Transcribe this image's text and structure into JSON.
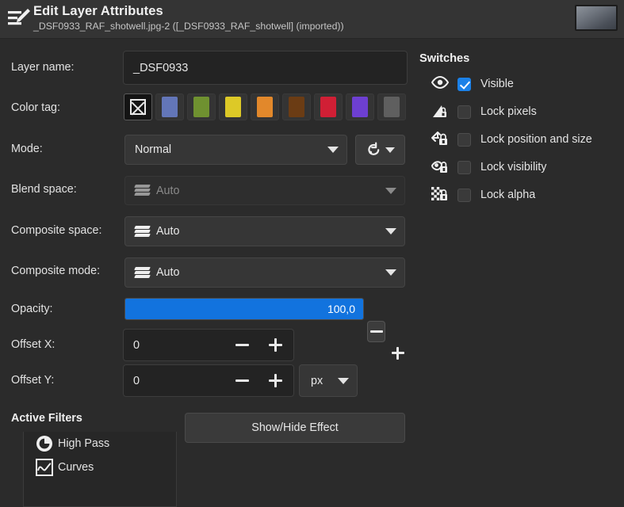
{
  "window": {
    "title": "Edit Layer Attributes",
    "subtitle": "_DSF0933_RAF_shotwell.jpg-2 ([_DSF0933_RAF_shotwell] (imported))",
    "header_icon": "edit-layer-attributes-icon",
    "thumbnail": "layer-thumbnail"
  },
  "form": {
    "layer_name": {
      "label": "Layer name:",
      "value": "_DSF0933"
    },
    "color_tag": {
      "label": "Color tag:",
      "selected_index": 0,
      "options": [
        {
          "name": "None",
          "color": "none"
        },
        {
          "name": "Blue",
          "color": "#6376b8"
        },
        {
          "name": "Green",
          "color": "#6f9130"
        },
        {
          "name": "Yellow",
          "color": "#ddc927"
        },
        {
          "name": "Orange",
          "color": "#e2882b"
        },
        {
          "name": "Brown",
          "color": "#6b3c14"
        },
        {
          "name": "Red",
          "color": "#d01f35"
        },
        {
          "name": "Violet",
          "color": "#6d3fd1"
        },
        {
          "name": "Gray",
          "color": "#5f5f5f"
        }
      ]
    },
    "mode": {
      "label": "Mode:",
      "value": "Normal",
      "reset_icon": "reset-icon"
    },
    "blend_space": {
      "label": "Blend space:",
      "value": "Auto",
      "disabled": true
    },
    "composite_space": {
      "label": "Composite space:",
      "value": "Auto",
      "disabled": false
    },
    "composite_mode": {
      "label": "Composite mode:",
      "value": "Auto",
      "disabled": false
    },
    "opacity": {
      "label": "Opacity:",
      "value": "100,0",
      "percent": 100,
      "fill_color": "#1273de",
      "minus": "minus-icon",
      "plus": "plus-icon"
    },
    "offset_x": {
      "label": "Offset X:",
      "value": "0"
    },
    "offset_y": {
      "label": "Offset Y:",
      "value": "0"
    },
    "unit": {
      "value": "px"
    }
  },
  "switches": {
    "title": "Switches",
    "items": [
      {
        "label": "Visible",
        "icon": "eye-icon",
        "checked": true
      },
      {
        "label": "Lock pixels",
        "icon": "lock-pixels-icon",
        "checked": false
      },
      {
        "label": "Lock position and size",
        "icon": "lock-position-icon",
        "checked": false
      },
      {
        "label": "Lock visibility",
        "icon": "lock-visibility-icon",
        "checked": false
      },
      {
        "label": "Lock alpha",
        "icon": "lock-alpha-icon",
        "checked": false
      }
    ]
  },
  "active_filters": {
    "title": "Active Filters",
    "show_hide_button": "Show/Hide Effect",
    "items": [
      {
        "label": "High Pass",
        "icon": "high-pass-icon"
      },
      {
        "label": "Curves",
        "icon": "curves-icon"
      }
    ]
  }
}
